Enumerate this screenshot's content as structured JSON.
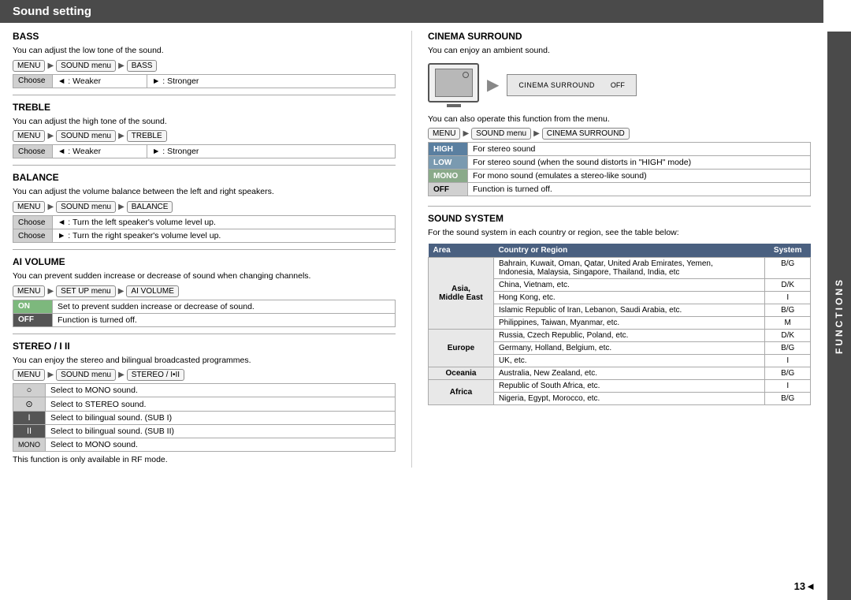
{
  "header": {
    "title": "Sound setting"
  },
  "functions_label": "FUNCTIONS",
  "page_number": "13",
  "left": {
    "bass": {
      "title": "BASS",
      "desc": "You can adjust the low tone of the sound.",
      "menu_path": [
        "MENU",
        "SOUND menu",
        "BASS"
      ],
      "choose_row": {
        "label": "Choose",
        "left": "◄ : Weaker",
        "right": "► : Stronger"
      }
    },
    "treble": {
      "title": "TREBLE",
      "desc": "You can adjust the high tone of the sound.",
      "menu_path": [
        "MENU",
        "SOUND menu",
        "TREBLE"
      ],
      "choose_row": {
        "label": "Choose",
        "left": "◄ : Weaker",
        "right": "► : Stronger"
      }
    },
    "balance": {
      "title": "BALANCE",
      "desc": "You can adjust the volume balance between the left and right speakers.",
      "menu_path": [
        "MENU",
        "SOUND menu",
        "BALANCE"
      ],
      "rows": [
        {
          "label": "Choose",
          "value": "◄ : Turn the left speaker's volume level up."
        },
        {
          "label": "Choose",
          "value": "► : Turn the right speaker's volume level up."
        }
      ]
    },
    "ai_volume": {
      "title": "AI VOLUME",
      "desc": "You can prevent sudden increase or decrease of sound when changing channels.",
      "menu_path_parts": [
        "MENU",
        "SET UP menu",
        "AI VOLUME"
      ],
      "rows": [
        {
          "label": "ON",
          "value": "Set to prevent sudden increase or decrease of sound."
        },
        {
          "label": "OFF",
          "value": "Function is turned off."
        }
      ]
    },
    "stereo": {
      "title": "STEREO / I II",
      "desc": "You can enjoy the stereo and bilingual broadcasted programmes.",
      "menu_path": [
        "MENU",
        "SOUND menu",
        "STEREO / I•II"
      ],
      "rows": [
        {
          "icon": "○",
          "value": "Select to MONO sound.",
          "dark": false
        },
        {
          "icon": "⊙",
          "value": "Select to STEREO sound.",
          "dark": false
        },
        {
          "icon": "I",
          "value": "Select to bilingual sound. (SUB I)",
          "dark": true
        },
        {
          "icon": "II",
          "value": "Select to bilingual sound. (SUB II)",
          "dark": true
        },
        {
          "icon": "MONO",
          "value": "Select to MONO sound.",
          "dark": false
        }
      ],
      "note": "This function is only available in RF mode."
    }
  },
  "right": {
    "cinema_surround": {
      "title": "CINEMA SURROUND",
      "desc": "You can enjoy an ambient sound.",
      "screen_label": "CINEMA SURROUND",
      "screen_value": "OFF",
      "note": "You can also operate this function from the menu.",
      "menu_path": [
        "MENU",
        "SOUND menu",
        "CINEMA SURROUND"
      ],
      "rows": [
        {
          "label": "HIGH",
          "value": "For stereo sound"
        },
        {
          "label": "LOW",
          "value": "For stereo sound (when the sound distorts in \"HIGH\" mode)"
        },
        {
          "label": "MONO",
          "value": "For mono sound (emulates a stereo-like sound)"
        },
        {
          "label": "OFF",
          "value": "Function is turned off."
        }
      ]
    },
    "sound_system": {
      "title": "SOUND SYSTEM",
      "desc": "For the sound system in each country or region, see the table below:",
      "table_headers": [
        "Area",
        "Country or Region",
        "System"
      ],
      "rows": [
        {
          "area": "Asia,\nMiddle East",
          "entries": [
            {
              "country": "Bahrain, Kuwait, Oman, Qatar, United Arab Emirates, Yemen,\nIndonesia, Malaysia, Singapore, Thailand, India, etc",
              "system": "B/G"
            },
            {
              "country": "China, Vietnam, etc.",
              "system": "D/K"
            },
            {
              "country": "Hong Kong, etc.",
              "system": "I"
            },
            {
              "country": "Islamic Republic of Iran, Lebanon, Saudi Arabia, etc.",
              "system": "B/G"
            },
            {
              "country": "Philippines, Taiwan, Myanmar, etc.",
              "system": "M"
            }
          ]
        },
        {
          "area": "Europe",
          "entries": [
            {
              "country": "Russia, Czech Republic, Poland, etc.",
              "system": "D/K"
            },
            {
              "country": "Germany, Holland, Belgium, etc.",
              "system": "B/G"
            },
            {
              "country": "UK, etc.",
              "system": "I"
            }
          ]
        },
        {
          "area": "Oceania",
          "entries": [
            {
              "country": "Australia, New Zealand, etc.",
              "system": "B/G"
            }
          ]
        },
        {
          "area": "Africa",
          "entries": [
            {
              "country": "Republic of South Africa, etc.",
              "system": "I"
            },
            {
              "country": "Nigeria, Egypt, Morocco, etc.",
              "system": "B/G"
            }
          ]
        }
      ]
    }
  }
}
